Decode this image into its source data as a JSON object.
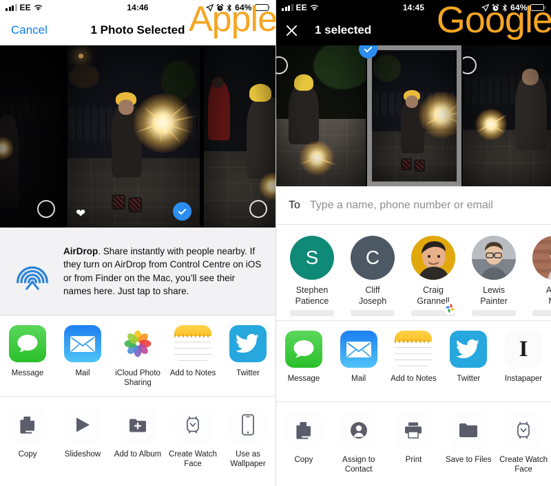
{
  "left": {
    "platform_watermark": "Apple",
    "watermark_color": "#f5a623",
    "statusbar": {
      "carrier": "EE",
      "time": "14:46",
      "battery_pct": "64%",
      "icons": [
        "signal-bars-icon",
        "wifi-icon",
        "location-arrow-icon",
        "alarm-clock-icon",
        "bluetooth-icon",
        "battery-icon"
      ]
    },
    "navbar": {
      "cancel_label": "Cancel",
      "title": "1 Photo Selected",
      "cancel_color": "#0a7cf3"
    },
    "photos": [
      {
        "name": "photo-thumb-left",
        "selected": false,
        "favorite": false,
        "selector": "empty-circle"
      },
      {
        "name": "photo-thumb-center",
        "selected": true,
        "favorite": true,
        "selector": "blue-check"
      },
      {
        "name": "photo-thumb-right",
        "selected": false,
        "favorite": false,
        "selector": "empty-circle"
      }
    ],
    "airdrop": {
      "icon": "airdrop-icon",
      "title": "AirDrop",
      "body": ". Share instantly with people nearby. If they turn on AirDrop from Control Centre on iOS or from Finder on the Mac, you’ll see their names here. Just tap to share."
    },
    "apps": [
      {
        "label": "Message",
        "icon": "message-icon"
      },
      {
        "label": "Mail",
        "icon": "mail-icon"
      },
      {
        "label": "iCloud Photo Sharing",
        "icon": "photos-icon"
      },
      {
        "label": "Add to Notes",
        "icon": "notes-icon"
      },
      {
        "label": "Twitter",
        "icon": "twitter-icon"
      }
    ],
    "actions": [
      {
        "label": "Copy",
        "icon": "copy-icon"
      },
      {
        "label": "Slideshow",
        "icon": "play-icon"
      },
      {
        "label": "Add to Album",
        "icon": "add-to-album-icon"
      },
      {
        "label": "Create Watch Face",
        "icon": "watch-icon"
      },
      {
        "label": "Use as Wallpaper",
        "icon": "iphone-icon"
      }
    ]
  },
  "right": {
    "platform_watermark": "Google",
    "watermark_color": "#f5a623",
    "statusbar": {
      "carrier": "EE",
      "time": "14:45",
      "battery_pct": "64%",
      "icons": [
        "signal-bars-icon",
        "wifi-icon",
        "location-arrow-icon",
        "alarm-clock-icon",
        "bluetooth-icon",
        "battery-icon"
      ]
    },
    "navbar": {
      "close_icon": "close-icon",
      "title": "1 selected"
    },
    "photos": [
      {
        "name": "photo-thumb-left",
        "selected": false,
        "selector": "empty-circle"
      },
      {
        "name": "photo-thumb-center",
        "selected": true,
        "selector": "blue-check"
      },
      {
        "name": "photo-thumb-right",
        "selected": false,
        "selector": "empty-circle"
      }
    ],
    "to_field": {
      "label": "To",
      "placeholder": "Type a name, phone number or email",
      "value": ""
    },
    "contacts": [
      {
        "name": "Stephen Patience",
        "line1": "Stephen",
        "line2": "Patience",
        "initial": "S",
        "color": "#0f8a77",
        "type": "initial"
      },
      {
        "name": "Cliff Joseph",
        "line1": "Cliff",
        "line2": "Joseph",
        "initial": "C",
        "color": "#4c5864",
        "type": "initial"
      },
      {
        "name": "Craig Grannell",
        "line1": "Craig",
        "line2": "Grannell",
        "initial": "",
        "color": "#e0a80d",
        "type": "photo",
        "badge": "google-photos-icon"
      },
      {
        "name": "Lewis Painter",
        "line1": "Lewis",
        "line2": "Painter",
        "initial": "",
        "color": "#8d9299",
        "type": "photo"
      },
      {
        "name": "Ashley Ma",
        "line1": "Ashl",
        "line2": "Ma",
        "initial": "",
        "color": "#a9715a",
        "type": "photo"
      }
    ],
    "apps": [
      {
        "label": "Message",
        "icon": "message-icon"
      },
      {
        "label": "Mail",
        "icon": "mail-icon"
      },
      {
        "label": "Add to Notes",
        "icon": "notes-icon"
      },
      {
        "label": "Twitter",
        "icon": "twitter-icon"
      },
      {
        "label": "Instapaper",
        "icon": "instapaper-icon"
      }
    ],
    "actions": [
      {
        "label": "Copy",
        "icon": "copy-icon"
      },
      {
        "label": "Assign to Contact",
        "icon": "assign-contact-icon"
      },
      {
        "label": "Print",
        "icon": "print-icon"
      },
      {
        "label": "Save to Files",
        "icon": "folder-icon"
      },
      {
        "label": "Create Watch Face",
        "icon": "watch-icon"
      }
    ]
  }
}
